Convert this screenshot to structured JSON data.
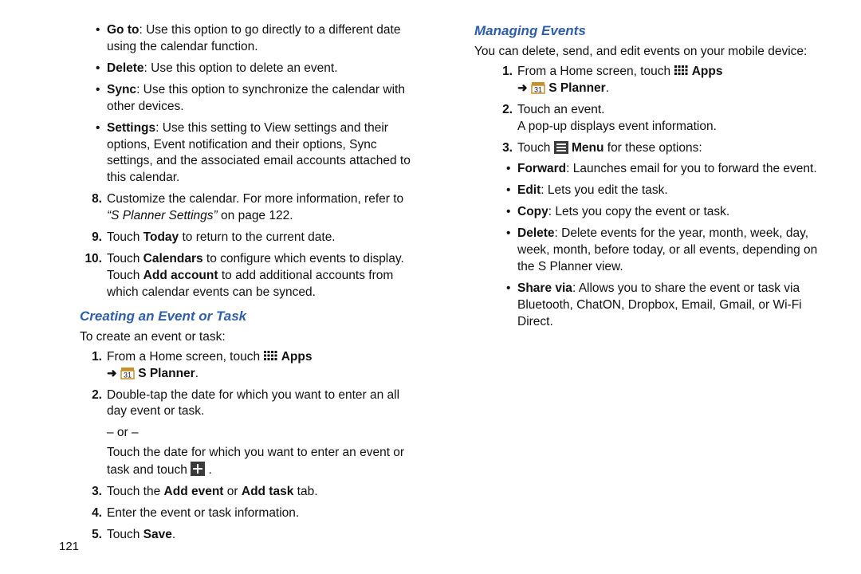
{
  "col1": {
    "sub_bullets": [
      {
        "term": "Go to",
        "desc": ": Use this option to go directly to a different date using the calendar function."
      },
      {
        "term": "Delete",
        "desc": ": Use this option to delete an event."
      },
      {
        "term": "Sync",
        "desc": ": Use this option to synchronize the calendar with other devices."
      },
      {
        "term": "Settings",
        "desc": ": Use this setting to View settings and their options, Event notification and their options, Sync settings, and the associated email accounts attached to this calendar."
      }
    ],
    "steps": [
      {
        "n": "8.",
        "pre": "  Customize the calendar. For more information, refer to ",
        "ital": "“S Planner Settings”",
        "post": " on page 122."
      },
      {
        "n": "9.",
        "text_a": "Touch ",
        "bold_a": "Today",
        "text_b": " to return to the current date."
      },
      {
        "n": "10.",
        "text_a": "Touch ",
        "bold_a": "Calendars",
        "text_b": " to configure which events to display. Touch ",
        "bold_b": "Add account",
        "text_c": " to add additional accounts from which calendar events can be synced."
      }
    ],
    "heading": "Creating an Event or Task",
    "intro": "To create an event or task:",
    "create_steps": {
      "s1": {
        "n": "1.",
        "a": "From a Home screen, touch ",
        "apps": "Apps",
        "arrow": "➜",
        "planner": "S Planner",
        "end": "."
      },
      "s2": {
        "n": "2.",
        "text": "Double-tap the date for which you want to enter an all day event or task."
      },
      "or": "– or –"
    }
  },
  "col2": {
    "top_text_a": "Touch the date for which you want to enter an event or task and touch ",
    "top_text_b": ".",
    "steps": {
      "s3": {
        "n": "3.",
        "a": "Touch the ",
        "b1": "Add event",
        "mid": " or ",
        "b2": "Add task",
        "end": "  tab."
      },
      "s4": {
        "n": "4.",
        "text": "Enter the event or task information."
      },
      "s5": {
        "n": "5.",
        "a": "Touch ",
        "b": "Save",
        "end": "."
      }
    },
    "heading": "Managing Events",
    "intro": "You can delete, send, and edit events on your mobile device:",
    "manage_steps": {
      "s1": {
        "n": "1.",
        "a": "From a Home screen, touch ",
        "apps": "Apps",
        "arrow": "➜",
        "planner": "S Planner",
        "end": "."
      },
      "s2": {
        "n": "2.",
        "a": "Touch an event.",
        "b": "A pop-up displays event information."
      },
      "s3": {
        "n": "3.",
        "a": "Touch ",
        "menu": "Menu",
        "b": " for these options:"
      }
    },
    "options": [
      {
        "term": "Forward",
        "desc": ": Launches email for you to forward the event."
      },
      {
        "term": "Edit",
        "desc": ": Lets you edit the task."
      },
      {
        "term": "Copy",
        "desc": ": Lets you copy the event or task."
      },
      {
        "term": "Delete",
        "desc": ": Delete events for the year, month, week, day, week, month, before today, or all events, depending on the S Planner view."
      },
      {
        "term": "Share via",
        "desc": ": Allows you to share the event or task via Bluetooth, ChatON, Dropbox, Email, Gmail, or Wi-Fi Direct."
      }
    ]
  },
  "page_number": "121"
}
